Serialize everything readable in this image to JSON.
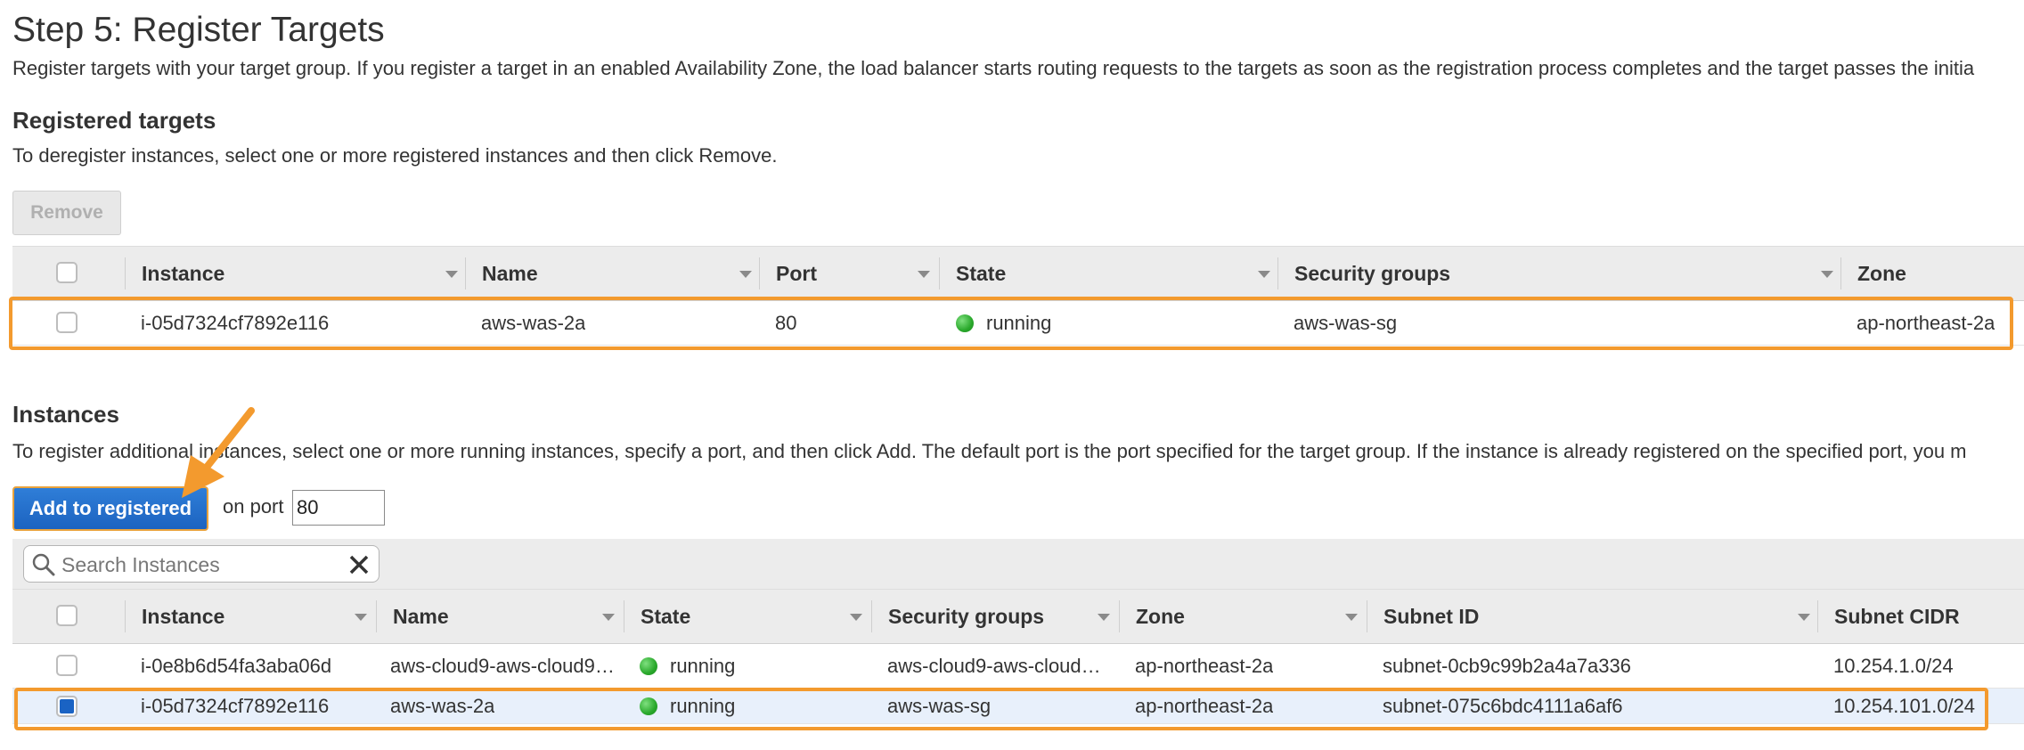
{
  "step": {
    "title": "Step 5: Register Targets",
    "description": "Register targets with your target group. If you register a target in an enabled Availability Zone, the load balancer starts routing requests to the targets as soon as the registration process completes and the target passes the initia"
  },
  "registered": {
    "heading": "Registered targets",
    "description": "To deregister instances, select one or more registered instances and then click Remove.",
    "remove_label": "Remove",
    "columns": [
      "Instance",
      "Name",
      "Port",
      "State",
      "Security groups",
      "Zone"
    ],
    "rows": [
      {
        "instance": "i-05d7324cf7892e116",
        "name": "aws-was-2a",
        "port": "80",
        "state": "running",
        "security_groups": "aws-was-sg",
        "zone": "ap-northeast-2a"
      }
    ]
  },
  "instances": {
    "heading": "Instances",
    "description": "To register additional instances, select one or more running instances, specify a port, and then click Add. The default port is the port specified for the target group. If the instance is already registered on the specified port, you m",
    "add_label": "Add to registered",
    "on_port_label": "on port",
    "port_value": "80",
    "search_placeholder": "Search Instances",
    "columns": [
      "Instance",
      "Name",
      "State",
      "Security groups",
      "Zone",
      "Subnet ID",
      "Subnet CIDR"
    ],
    "rows": [
      {
        "instance": "i-0e8b6d54fa3aba06d",
        "name": "aws-cloud9-aws-cloud9…",
        "state": "running",
        "security_groups": "aws-cloud9-aws-cloud…",
        "zone": "ap-northeast-2a",
        "subnet_id": "subnet-0cb9c99b2a4a7a336",
        "subnet_cidr": "10.254.1.0/24",
        "selected": false
      },
      {
        "instance": "i-05d7324cf7892e116",
        "name": "aws-was-2a",
        "state": "running",
        "security_groups": "aws-was-sg",
        "zone": "ap-northeast-2a",
        "subnet_id": "subnet-075c6bdc4111a6af6",
        "subnet_cidr": "10.254.101.0/24",
        "selected": true
      }
    ]
  },
  "colors": {
    "highlight": "#f39a2e",
    "primary_button": "#1c63c0",
    "running": "#29a82b"
  }
}
